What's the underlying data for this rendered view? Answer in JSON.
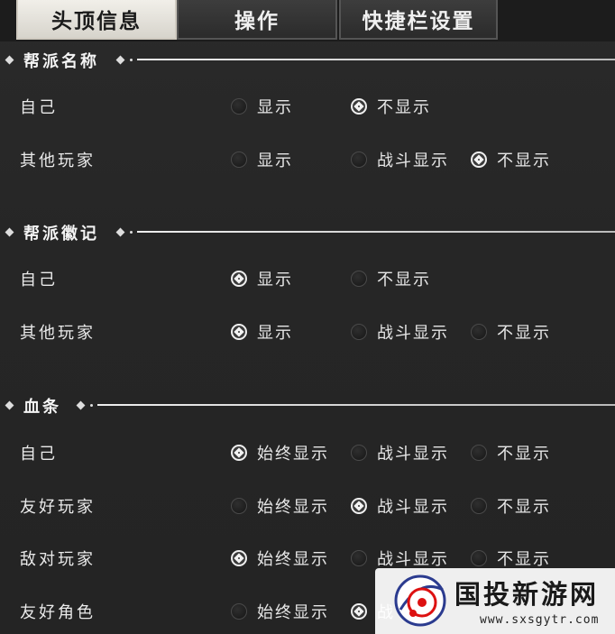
{
  "tabs": [
    "头顶信息",
    "操作",
    "快捷栏设置"
  ],
  "sections": {
    "guild_name": {
      "title": "帮派名称",
      "rows": [
        {
          "label": "自己",
          "options": [
            "显示",
            "不显示"
          ],
          "selected": "不显示"
        },
        {
          "label": "其他玩家",
          "options": [
            "显示",
            "战斗显示",
            "不显示"
          ],
          "selected": "不显示"
        }
      ]
    },
    "guild_emblem": {
      "title": "帮派徽记",
      "rows": [
        {
          "label": "自己",
          "options": [
            "显示",
            "不显示"
          ],
          "selected": "显示"
        },
        {
          "label": "其他玩家",
          "options": [
            "显示",
            "战斗显示",
            "不显示"
          ],
          "selected": "显示"
        }
      ]
    },
    "health_bar": {
      "title": "血条",
      "rows": [
        {
          "label": "自己",
          "options": [
            "始终显示",
            "战斗显示",
            "不显示"
          ],
          "selected": "始终显示"
        },
        {
          "label": "友好玩家",
          "options": [
            "始终显示",
            "战斗显示",
            "不显示"
          ],
          "selected": "战斗显示"
        },
        {
          "label": "敌对玩家",
          "options": [
            "始终显示",
            "战斗显示",
            "不显示"
          ],
          "selected": "始终显示"
        },
        {
          "label": "友好角色",
          "options": [
            "始终显示",
            "战"
          ],
          "selected": "战"
        }
      ]
    }
  },
  "watermark": {
    "text": "国投新游网",
    "url": "www.sxsgytr.com"
  }
}
